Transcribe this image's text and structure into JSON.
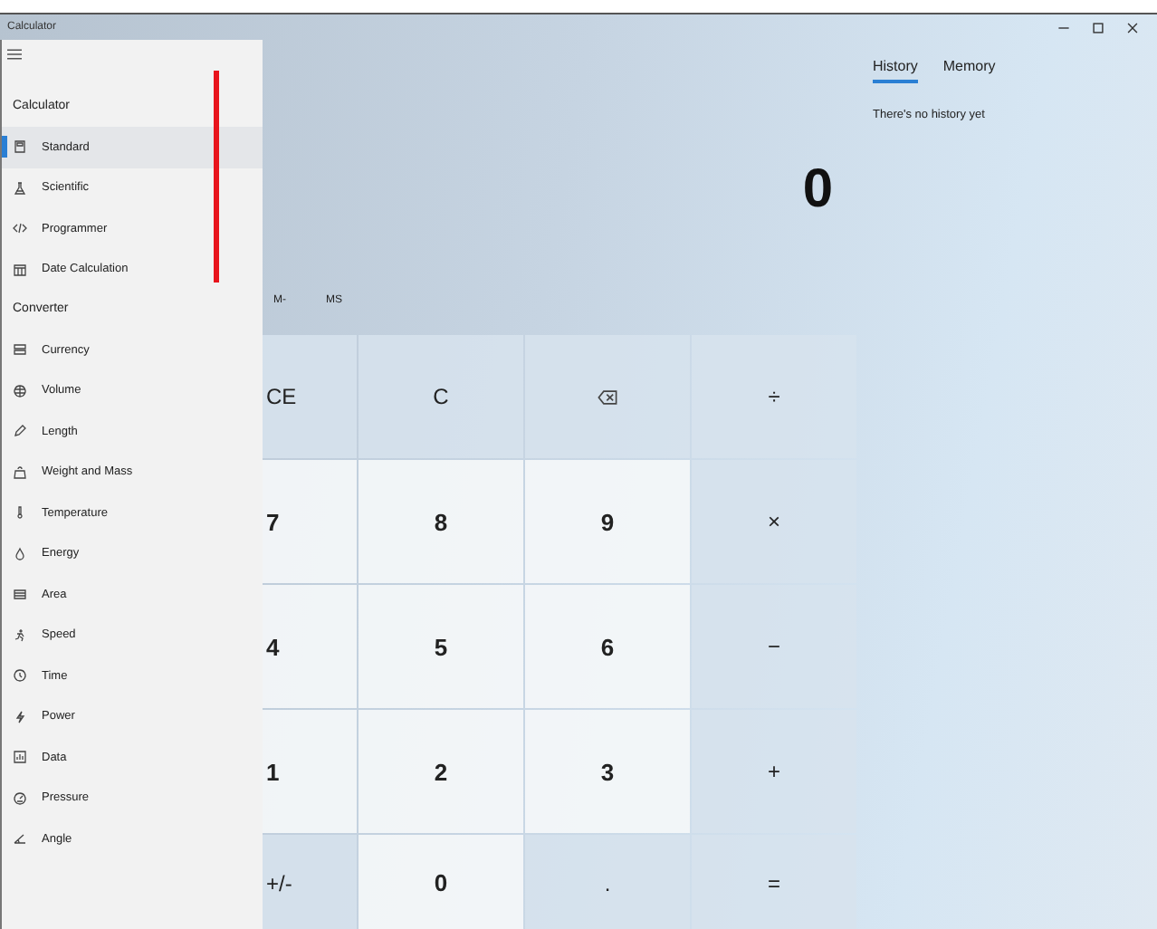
{
  "window": {
    "title": "Calculator"
  },
  "sidebar": {
    "sections": [
      {
        "title": "Calculator",
        "items": [
          {
            "label": "Standard",
            "selected": true
          },
          {
            "label": "Scientific",
            "selected": false
          },
          {
            "label": "Programmer",
            "selected": false
          },
          {
            "label": "Date Calculation",
            "selected": false
          }
        ]
      },
      {
        "title": "Converter",
        "items": [
          {
            "label": "Currency",
            "selected": false
          },
          {
            "label": "Volume",
            "selected": false
          },
          {
            "label": "Length",
            "selected": false
          },
          {
            "label": "Weight and Mass",
            "selected": false
          },
          {
            "label": "Temperature",
            "selected": false
          },
          {
            "label": "Energy",
            "selected": false
          },
          {
            "label": "Area",
            "selected": false
          },
          {
            "label": "Speed",
            "selected": false
          },
          {
            "label": "Time",
            "selected": false
          },
          {
            "label": "Power",
            "selected": false
          },
          {
            "label": "Data",
            "selected": false
          },
          {
            "label": "Pressure",
            "selected": false
          },
          {
            "label": "Angle",
            "selected": false
          }
        ]
      }
    ]
  },
  "display": {
    "value": "0"
  },
  "memory_buttons": [
    "M-",
    "MS"
  ],
  "keypad": [
    [
      {
        "kind": "function",
        "label": "CE"
      },
      {
        "kind": "function",
        "label": "C"
      },
      {
        "kind": "backspace"
      },
      {
        "kind": "function",
        "label": "÷"
      }
    ],
    [
      {
        "kind": "digit",
        "label": "7"
      },
      {
        "kind": "digit",
        "label": "8"
      },
      {
        "kind": "digit",
        "label": "9"
      },
      {
        "kind": "function",
        "label": "×"
      }
    ],
    [
      {
        "kind": "digit",
        "label": "4"
      },
      {
        "kind": "digit",
        "label": "5"
      },
      {
        "kind": "digit",
        "label": "6"
      },
      {
        "kind": "function",
        "label": "−"
      }
    ],
    [
      {
        "kind": "digit",
        "label": "1"
      },
      {
        "kind": "digit",
        "label": "2"
      },
      {
        "kind": "digit",
        "label": "3"
      },
      {
        "kind": "function",
        "label": "+"
      }
    ],
    [
      {
        "kind": "function",
        "label": "+/-"
      },
      {
        "kind": "digit",
        "label": "0"
      },
      {
        "kind": "function",
        "label": "."
      },
      {
        "kind": "function",
        "label": "="
      }
    ]
  ],
  "history": {
    "tabs": [
      {
        "label": "History",
        "selected": true
      },
      {
        "label": "Memory",
        "selected": false
      }
    ],
    "message": "There's no history yet"
  }
}
